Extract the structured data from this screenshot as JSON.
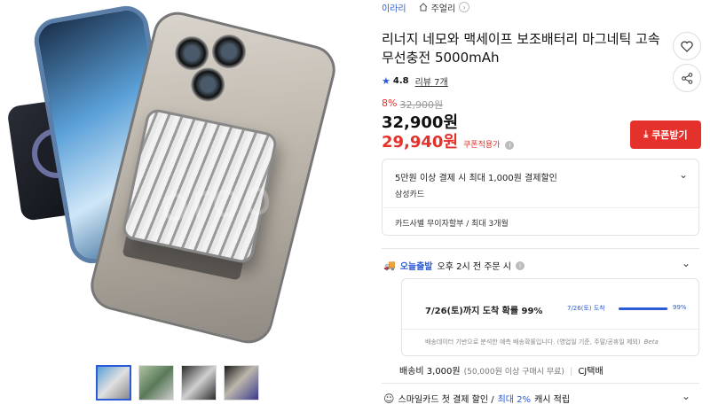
{
  "breadcrumb": {
    "brand": "이라리",
    "category": "주얼리"
  },
  "product": {
    "title": "리너지 네모와 맥세이프 보조배터리 마그네틱 고속 무선충전 5000mAh",
    "rating": "4.8",
    "review_count": "리뷰 7개",
    "discount_percent": "8%",
    "original_price": "32,900원",
    "price": "32,900원",
    "coupon_price": "29,940원",
    "coupon_price_label": "쿠폰적용가",
    "coupon_button": "쿠폰받기",
    "image_watermark": "oroo"
  },
  "card_benefit": {
    "title": "5만원 이상 결제 시 최대 1,000원 결제할인",
    "card": "삼성카드",
    "installment": "카드사별 무이자할부 / 최대 3개월"
  },
  "shipping": {
    "badge": "오늘출발",
    "cutoff": "오후 2시 전 주문 시",
    "arrival_text": "7/26(토)까지 도착 확률 99%",
    "bar_label": "7/26(토) 도착",
    "bar_percent": "99%",
    "bar_value": 0.99,
    "note": "배송데이터 기반으로 분석한 예측 배송확률입니다. (영업일 기준, 주말/공휴일 제외)",
    "note_beta": "Beta",
    "fee": "배송비 3,000원",
    "fee_condition": "(50,000원 이상 구매시 무료)",
    "carrier": "CJ택배"
  },
  "promo": {
    "prefix": "스마일카드 첫 결제 할인 /",
    "highlight": "최대 2%",
    "suffix": "캐시 적립"
  },
  "colors": {
    "accent": "#2b5bd7",
    "sale": "#e4312b"
  }
}
